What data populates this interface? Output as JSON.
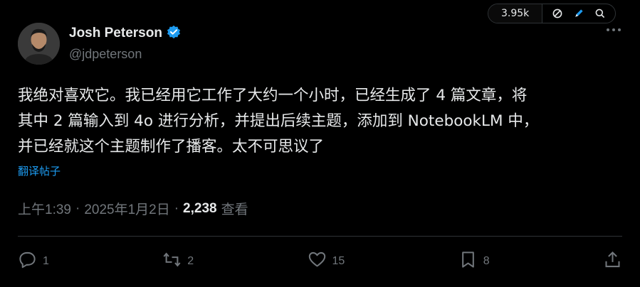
{
  "top_bar": {
    "view_count": "3.95k",
    "icons": [
      "block-icon",
      "pen-icon",
      "search-icon"
    ]
  },
  "author": {
    "name": "Josh Peterson",
    "handle": "@jdpeterson",
    "verified": true,
    "verified_color": "#1d9bf0"
  },
  "tweet": {
    "text": "我绝对喜欢它。我已经用它工作了大约一个小时，已经生成了 4 篇文章，将\n其中 2 篇输入到 4o 进行分析，并提出后续主题，添加到 NotebookLM 中，\n并已经就这个主题制作了播客。太不可思议了",
    "translate_label": "翻译帖子"
  },
  "meta": {
    "time": "上午1:39",
    "separator": "·",
    "date": "2025年1月2日",
    "views_count": "2,238",
    "views_label": "查看"
  },
  "actions": {
    "reply_count": "1",
    "retweet_count": "2",
    "like_count": "15",
    "bookmark_count": "8"
  },
  "colors": {
    "background": "#000000",
    "text": "#e7e9ea",
    "muted": "#71767b",
    "accent": "#1d9bf0",
    "border": "#2f3336"
  }
}
